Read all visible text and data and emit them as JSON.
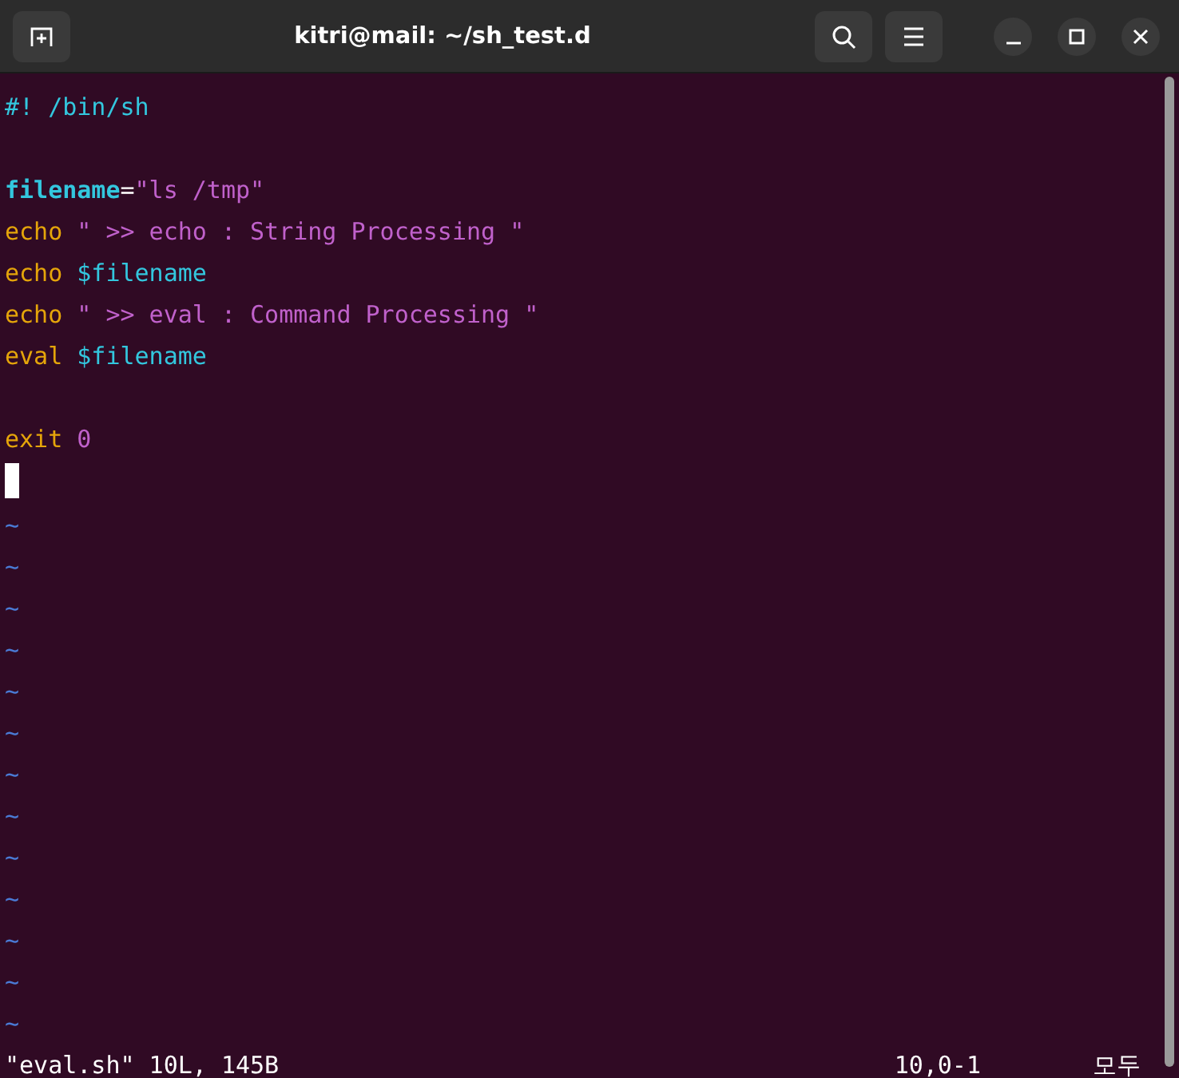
{
  "window": {
    "title": "kitri@mail: ~/sh_test.d"
  },
  "editor": {
    "lines": [
      {
        "kind": "code",
        "segments": [
          {
            "kind": "comment",
            "text": "#! /bin/sh"
          }
        ]
      },
      {
        "kind": "blank"
      },
      {
        "kind": "code",
        "segments": [
          {
            "kind": "ident",
            "text": "filename"
          },
          {
            "kind": "plain",
            "text": "="
          },
          {
            "kind": "string",
            "text": "\"ls /tmp\""
          }
        ]
      },
      {
        "kind": "code",
        "segments": [
          {
            "kind": "keyword",
            "text": "echo"
          },
          {
            "kind": "string",
            "text": " \" >> echo : String Processing \""
          }
        ]
      },
      {
        "kind": "code",
        "segments": [
          {
            "kind": "keyword",
            "text": "echo"
          },
          {
            "kind": "var",
            "text": " $filename"
          }
        ]
      },
      {
        "kind": "code",
        "segments": [
          {
            "kind": "keyword",
            "text": "echo"
          },
          {
            "kind": "string",
            "text": " \" >> eval : Command Processing \""
          }
        ]
      },
      {
        "kind": "code",
        "segments": [
          {
            "kind": "keyword",
            "text": "eval"
          },
          {
            "kind": "var",
            "text": " $filename"
          }
        ]
      },
      {
        "kind": "blank"
      },
      {
        "kind": "code",
        "segments": [
          {
            "kind": "keyword",
            "text": "exit"
          },
          {
            "kind": "number",
            "text": " 0"
          }
        ]
      }
    ],
    "tildes": [
      "~",
      "~",
      "~",
      "~",
      "~",
      "~",
      "~",
      "~",
      "~",
      "~",
      "~",
      "~",
      "~"
    ]
  },
  "status_bar": {
    "message": "\"eval.sh\" 10L, 145B",
    "position": "10,0-1",
    "scroll": "모두"
  }
}
